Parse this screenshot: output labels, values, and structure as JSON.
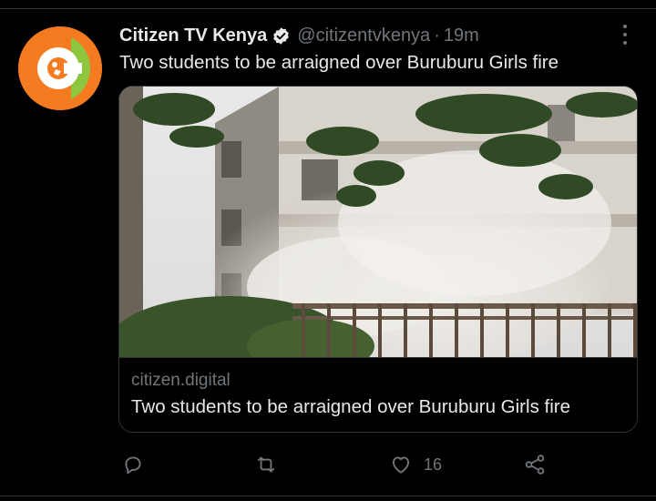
{
  "tweet": {
    "display_name": "Citizen TV Kenya",
    "handle": "@citizentvkenya",
    "separator": "·",
    "time": "19m",
    "text": "Two students to be arraigned over Buruburu Girls fire",
    "verified": true
  },
  "card": {
    "domain": "citizen.digital",
    "title": "Two students to be arraigned over Buruburu Girls fire"
  },
  "actions": {
    "reply_count": "",
    "retweet_count": "",
    "like_count": "16"
  },
  "icons": {
    "avatar": "citizen-tv-logo",
    "verified": "verified-badge-icon",
    "more": "more-options-icon",
    "reply": "reply-icon",
    "retweet": "retweet-icon",
    "like": "heart-icon",
    "share": "share-icon"
  },
  "colors": {
    "background": "#000000",
    "primary_text": "#e7e9ea",
    "secondary_text": "#71767b",
    "border": "#2f3336",
    "logo_orange": "#f47b20",
    "logo_green": "#8dc63f"
  }
}
